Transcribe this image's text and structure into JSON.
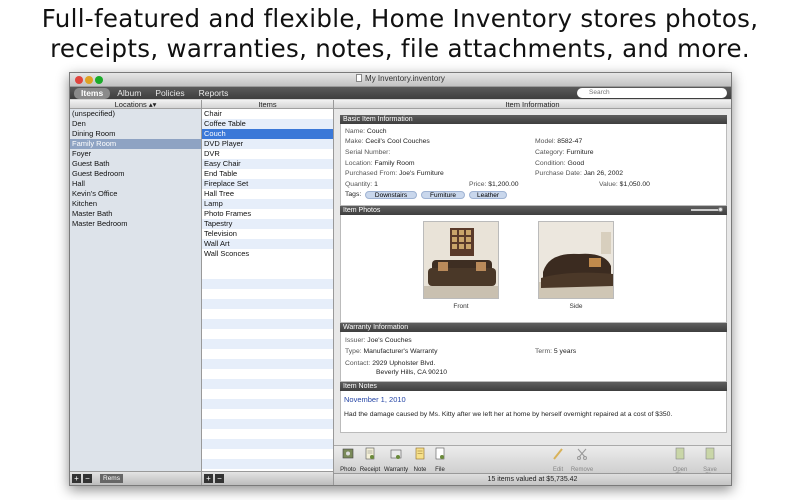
{
  "headline": {
    "line1": "Full-featured and flexible, Home Inventory stores photos,",
    "line2": "receipts, warranties, notes, file attachments, and more."
  },
  "window": {
    "title": "My Inventory.inventory"
  },
  "toolbar": {
    "tabs": [
      "Items",
      "Album",
      "Policies",
      "Reports"
    ],
    "search_placeholder": "Search"
  },
  "locations": {
    "header": "Locations ▴▾",
    "items": [
      "(unspecified)",
      "Den",
      "Dining Room",
      "Family Room",
      "Foyer",
      "Guest Bath",
      "Guest Bedroom",
      "Hall",
      "Kevin's Office",
      "Kitchen",
      "Master Bath",
      "Master Bedroom"
    ],
    "selected": "Family Room",
    "bottom_button": "Rems"
  },
  "items": {
    "header": "Items",
    "rows": [
      "Chair",
      "Coffee Table",
      "Couch",
      "DVD Player",
      "DVR",
      "Easy Chair",
      "End Table",
      "Fireplace Set",
      "Hall Tree",
      "Lamp",
      "Photo Frames",
      "Tapestry",
      "Television",
      "Wall Art",
      "Wall Sconces"
    ],
    "selected": "Couch"
  },
  "info": {
    "header": "Item Information",
    "basic": {
      "title": "Basic Item Information",
      "name_label": "Name:",
      "name": "Couch",
      "make_label": "Make:",
      "make": "Cecil's Cool Couches",
      "serial_label": "Serial Number:",
      "serial": "",
      "location_label": "Location:",
      "location": "Family Room",
      "purchased_from_label": "Purchased From:",
      "purchased_from": "Joe's Furniture",
      "quantity_label": "Quantity:",
      "quantity": "1",
      "tags_label": "Tags:",
      "model_label": "Model:",
      "model": "8582-47",
      "category_label": "Category:",
      "category": "Furniture",
      "condition_label": "Condition:",
      "condition": "Good",
      "purchase_date_label": "Purchase Date:",
      "purchase_date": "Jan 26, 2002",
      "price_label": "Price:",
      "price": "$1,200.00",
      "value_label": "Value:",
      "value": "$1,050.00",
      "tags": [
        "Downstairs",
        "Furniture",
        "Leather"
      ]
    },
    "photos": {
      "title": "Item Photos",
      "captions": [
        "Front",
        "Side"
      ]
    },
    "warranty": {
      "title": "Warranty Information",
      "issuer_label": "Issuer:",
      "issuer": "Joe's Couches",
      "type_label": "Type:",
      "type": "Manufacturer's Warranty",
      "term_label": "Term:",
      "term": "5 years",
      "contact_label": "Contact:",
      "contact_line1": "2929 Upholster Blvd.",
      "contact_line2": "Beverly Hills, CA 90210"
    },
    "notes": {
      "title": "Item Notes",
      "date": "November 1, 2010",
      "text": "Had the damage caused by Ms. Kitty after we left her at home by herself overnight repaired at a cost of $350."
    }
  },
  "actions": {
    "photo": "Photo",
    "receipt": "Receipt",
    "warranty": "Warranty",
    "note": "Note",
    "file": "File",
    "edit": "Edit",
    "remove": "Remove",
    "open_file": "Open File",
    "save_file": "Save File"
  },
  "status": "15 items valued at $5,735.42",
  "colors": {
    "selection": "#3a78d8",
    "source_selection": "#8ea3c3",
    "note_date": "#2646a6"
  }
}
